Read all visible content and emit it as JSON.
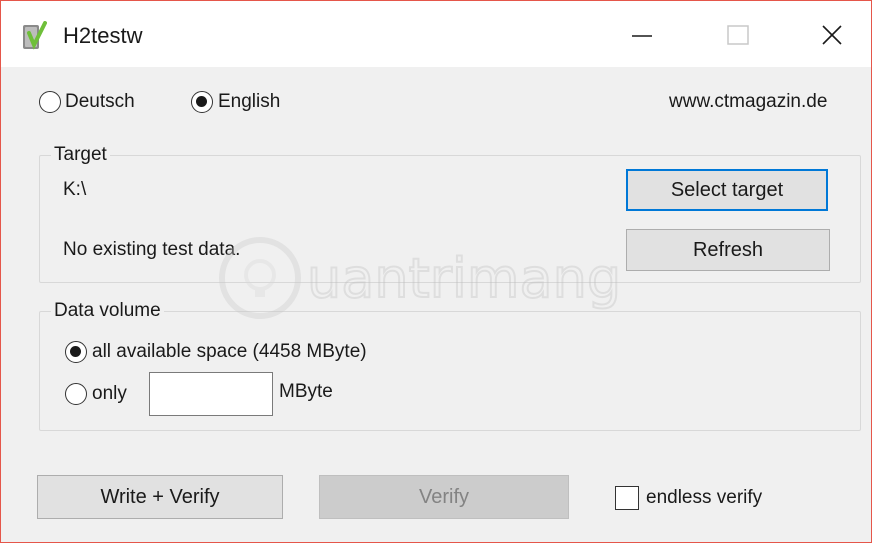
{
  "window": {
    "title": "H2testw",
    "icons": {
      "app": "h2testw-app-icon",
      "minimize": "minimize-icon",
      "maximize": "maximize-icon",
      "close": "close-icon"
    }
  },
  "language": {
    "options": [
      {
        "label": "Deutsch",
        "selected": false
      },
      {
        "label": "English",
        "selected": true
      }
    ],
    "website": "www.ctmagazin.de"
  },
  "target": {
    "group_title": "Target",
    "path": "K:\\",
    "status": "No existing test data.",
    "select_button": "Select target",
    "refresh_button": "Refresh"
  },
  "data_volume": {
    "group_title": "Data volume",
    "option_all": "all available space (4458 MByte)",
    "option_only": "only",
    "only_value": "",
    "unit": "MByte",
    "selected": "all"
  },
  "actions": {
    "write_verify": "Write + Verify",
    "verify": "Verify",
    "endless_verify": "endless verify",
    "endless_verify_checked": false
  },
  "colors": {
    "focus_border": "#0078d7",
    "window_border": "#e5564a",
    "disabled_bg": "#cccccc"
  }
}
